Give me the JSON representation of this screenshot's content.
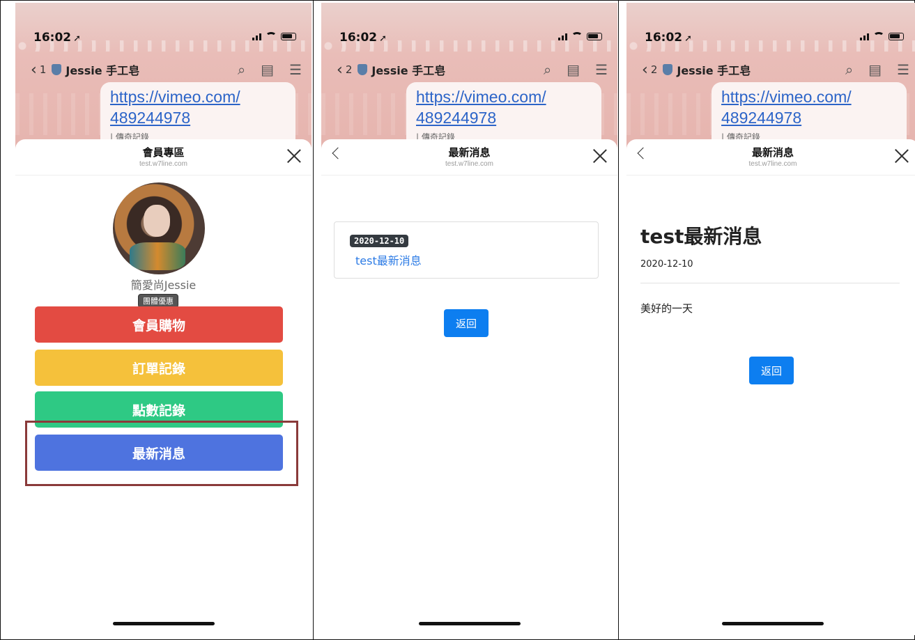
{
  "status": {
    "time": "16:02"
  },
  "chat": {
    "room_name": "Jessie 手工皂",
    "link_line1": "https://vimeo.com/",
    "link_line2": "489244978",
    "truncated_text": "| 傳奇記錄",
    "panels_unread": [
      "1",
      "2",
      "2"
    ]
  },
  "panel1": {
    "sheet_title": "會員專區",
    "sheet_domain": "test.w7line.com",
    "user_name": "簡愛尚Jessie",
    "user_tag": "團體優惠",
    "buttons": [
      "會員購物",
      "訂單記錄",
      "點數記錄",
      "最新消息"
    ],
    "colors": {
      "shop": "#e34b42",
      "orders": "#f5c13b",
      "points": "#2ec984",
      "news": "#4e73df",
      "highlight": "#8a3a3a"
    }
  },
  "panel2": {
    "sheet_title": "最新消息",
    "sheet_domain": "test.w7line.com",
    "news_date": "2020-12-10",
    "news_title": "test最新消息",
    "back_label": "返回"
  },
  "panel3": {
    "sheet_title": "最新消息",
    "sheet_domain": "test.w7line.com",
    "article_title": "test最新消息",
    "article_date": "2020-12-10",
    "article_body": "美好的一天",
    "back_label": "返回"
  }
}
